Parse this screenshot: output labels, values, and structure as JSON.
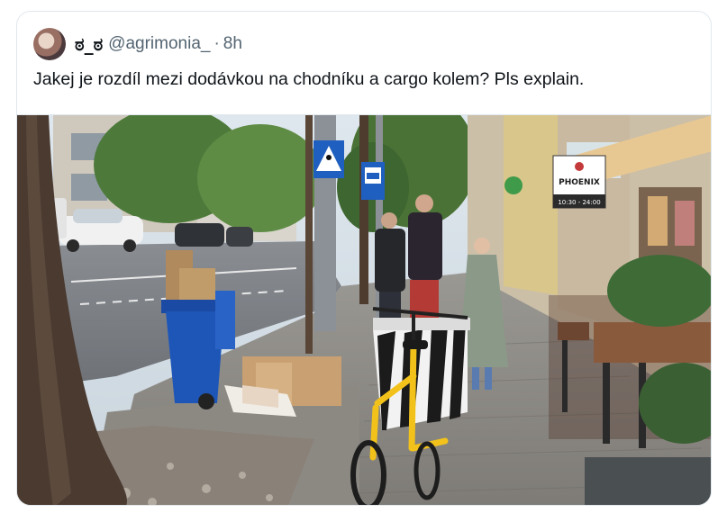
{
  "tweet": {
    "display_name": "ಠ_ಠ",
    "handle": "@agrimonia_",
    "separator": "·",
    "timestamp": "8h",
    "text": "Jakej je rozdíl mezi dodávkou na chodníku a cargo kolem? Pls explain."
  },
  "photo": {
    "sign_text": "PHOENIX",
    "sign_hours": "10:30 - 24:00",
    "icons": [
      "pedestrian-crossing-sign",
      "parking-sign"
    ]
  },
  "colors": {
    "text_primary": "#0f1419",
    "text_secondary": "#536471",
    "border": "#e1e8ed",
    "bike_yellow": "#f2c21b",
    "bin_blue": "#1e56b8"
  }
}
